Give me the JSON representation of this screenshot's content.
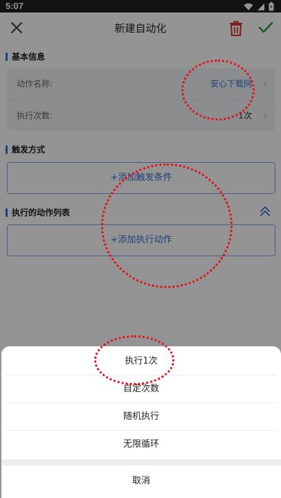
{
  "status_bar": {
    "time": "5:07"
  },
  "app_bar": {
    "title": "新建自动化"
  },
  "sections": {
    "basic_info": {
      "title": "基本信息",
      "rows": [
        {
          "label": "动作名称:",
          "value": "安心下载网"
        },
        {
          "label": "执行次数:",
          "value": "1次"
        }
      ]
    },
    "trigger": {
      "title": "触发方式",
      "add_label": "+添加触发条件"
    },
    "actions": {
      "title": "执行的动作列表",
      "add_label": "+添加执行动作"
    }
  },
  "bottom_sheet": {
    "options": [
      "执行1次",
      "自定次数",
      "随机执行",
      "无限循环"
    ],
    "cancel_label": "取消"
  },
  "colors": {
    "accent": "#3a6fd8",
    "delete": "#d0312d",
    "confirm": "#2e9d3a",
    "annotation": "#e0141e"
  },
  "icons": [
    "wifi-icon",
    "signal-icon",
    "battery-icon",
    "close-icon",
    "trash-icon",
    "check-icon",
    "chevron-right-icon",
    "double-chevron-up-icon"
  ]
}
